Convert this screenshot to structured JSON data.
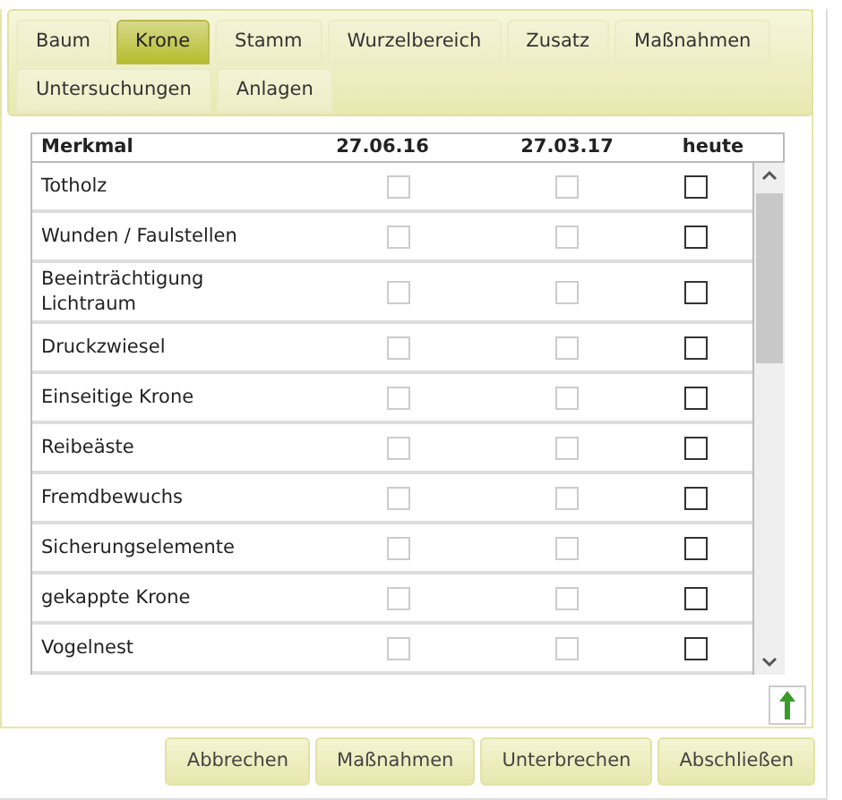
{
  "tabs": [
    {
      "label": "Baum",
      "selected": false
    },
    {
      "label": "Krone",
      "selected": true
    },
    {
      "label": "Stamm",
      "selected": false
    },
    {
      "label": "Wurzelbereich",
      "selected": false
    },
    {
      "label": "Zusatz",
      "selected": false
    },
    {
      "label": "Maßnahmen",
      "selected": false
    },
    {
      "label": "Untersuchungen",
      "selected": false
    },
    {
      "label": "Anlagen",
      "selected": false
    }
  ],
  "table": {
    "columns": [
      "Merkmal",
      "27.06.16",
      "27.03.17",
      "heute"
    ],
    "rows": [
      {
        "label": "Totholz",
        "checks": [
          {
            "checked": false,
            "disabled": true
          },
          {
            "checked": false,
            "disabled": true
          },
          {
            "checked": false,
            "disabled": false
          }
        ]
      },
      {
        "label": "Wunden / Faulstellen",
        "checks": [
          {
            "checked": false,
            "disabled": true
          },
          {
            "checked": false,
            "disabled": true
          },
          {
            "checked": false,
            "disabled": false
          }
        ]
      },
      {
        "label": "Beeinträchtigung Lichtraum",
        "checks": [
          {
            "checked": false,
            "disabled": true
          },
          {
            "checked": false,
            "disabled": true
          },
          {
            "checked": false,
            "disabled": false
          }
        ]
      },
      {
        "label": "Druckzwiesel",
        "checks": [
          {
            "checked": false,
            "disabled": true
          },
          {
            "checked": false,
            "disabled": true
          },
          {
            "checked": false,
            "disabled": false
          }
        ]
      },
      {
        "label": "Einseitige Krone",
        "checks": [
          {
            "checked": false,
            "disabled": true
          },
          {
            "checked": false,
            "disabled": true
          },
          {
            "checked": false,
            "disabled": false
          }
        ]
      },
      {
        "label": "Reibeäste",
        "checks": [
          {
            "checked": false,
            "disabled": true
          },
          {
            "checked": false,
            "disabled": true
          },
          {
            "checked": false,
            "disabled": false
          }
        ]
      },
      {
        "label": "Fremdbewuchs",
        "checks": [
          {
            "checked": false,
            "disabled": true
          },
          {
            "checked": false,
            "disabled": true
          },
          {
            "checked": false,
            "disabled": false
          }
        ]
      },
      {
        "label": "Sicherungselemente",
        "checks": [
          {
            "checked": false,
            "disabled": true
          },
          {
            "checked": false,
            "disabled": true
          },
          {
            "checked": false,
            "disabled": false
          }
        ]
      },
      {
        "label": "gekappte Krone",
        "checks": [
          {
            "checked": false,
            "disabled": true
          },
          {
            "checked": false,
            "disabled": true
          },
          {
            "checked": false,
            "disabled": false
          }
        ]
      },
      {
        "label": "Vogelnest",
        "checks": [
          {
            "checked": false,
            "disabled": true
          },
          {
            "checked": false,
            "disabled": true
          },
          {
            "checked": false,
            "disabled": false
          }
        ]
      }
    ]
  },
  "buttons": [
    "Abbrechen",
    "Maßnahmen",
    "Unterbrechen",
    "Abschließen"
  ]
}
